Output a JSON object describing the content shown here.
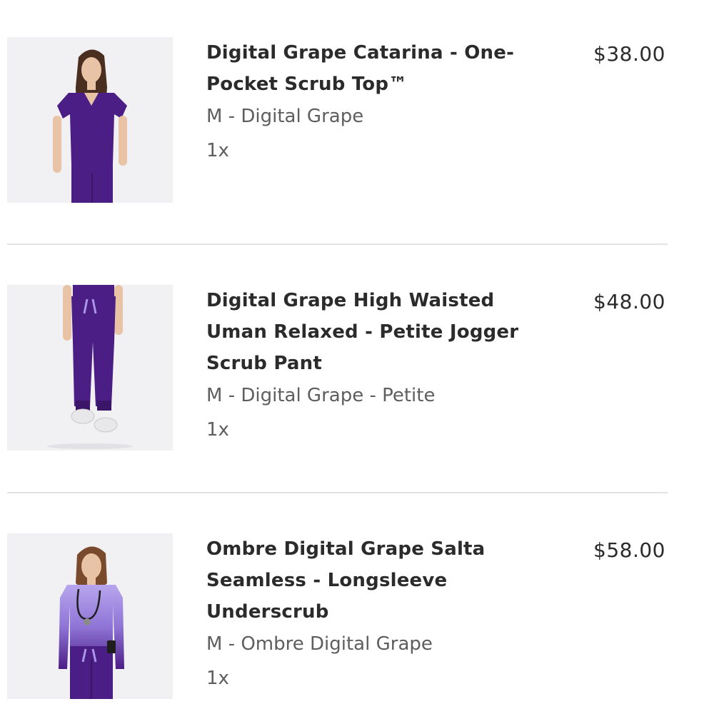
{
  "cart": {
    "items": [
      {
        "title_lines": [
          "Digital Grape Catarina - One-",
          "Pocket Scrub Top™"
        ],
        "variant": "M - Digital Grape",
        "quantity": "1x",
        "price": "$38.00",
        "image_icon": "scrub-top-photo"
      },
      {
        "title_lines": [
          "Digital Grape High Waisted",
          "Uman Relaxed - Petite Jogger",
          "Scrub Pant"
        ],
        "variant": "M - Digital Grape - Petite",
        "quantity": "1x",
        "price": "$48.00",
        "image_icon": "jogger-pant-photo"
      },
      {
        "title_lines": [
          "Ombre Digital Grape Salta",
          "Seamless - Longsleeve",
          "Underscrub"
        ],
        "variant": "M - Ombre Digital Grape",
        "quantity": "1x",
        "price": "$58.00",
        "image_icon": "underscrub-photo"
      }
    ]
  },
  "colors": {
    "grape": "#4b1e86",
    "lavender": "#a996e8",
    "text_dark": "#2b2b2b",
    "text_muted": "#5e5e5e"
  }
}
